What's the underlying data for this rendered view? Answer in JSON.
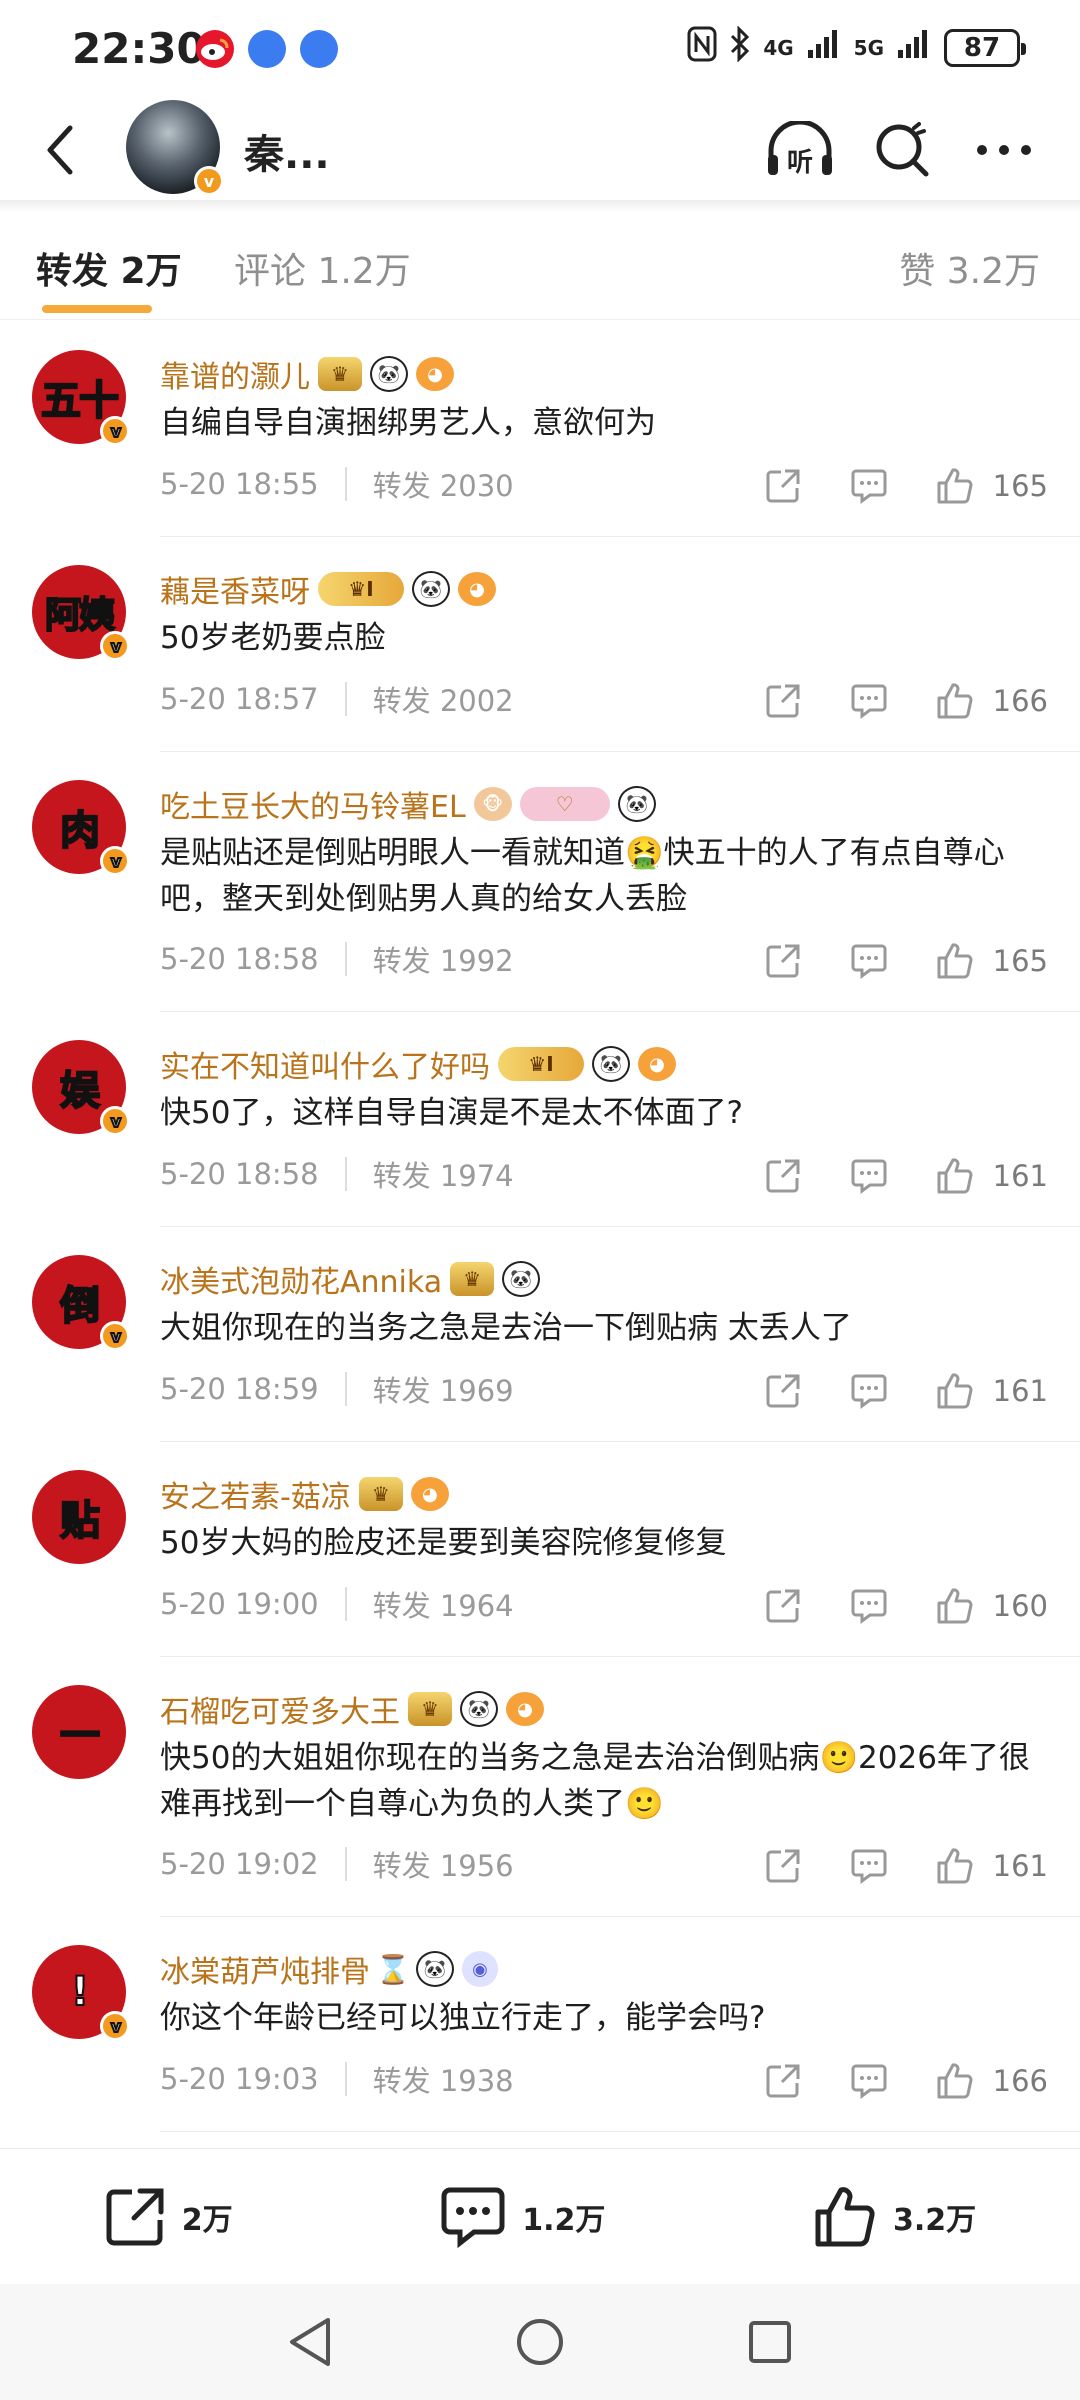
{
  "status_bar": {
    "time": "22:30",
    "network_1": "4G",
    "network_2": "5G",
    "battery": "87"
  },
  "header": {
    "title": "秦...",
    "listen_label": "听"
  },
  "tabs": [
    {
      "label": "转发 2万"
    },
    {
      "label": "评论 1.2万"
    },
    {
      "label": "赞 3.2万"
    }
  ],
  "items": [
    {
      "avatar_text": "五十",
      "name": "靠谱的灏儿",
      "badges": [
        "crown",
        "panda",
        "fish"
      ],
      "text": "自编自导自演捆绑男艺人，意欲何为",
      "time": "5-20 18:55",
      "repost": "转发 2030",
      "likes": "165"
    },
    {
      "avatar_text": "阿姨",
      "name": "藕是香菜呀",
      "badges": [
        "level",
        "panda",
        "fish"
      ],
      "level_label": "I",
      "text": "50岁老奶要点脸",
      "time": "5-20 18:57",
      "repost": "转发 2002",
      "likes": "166"
    },
    {
      "avatar_text": "肉",
      "name": "吃土豆长大的马铃薯EL",
      "badges": [
        "monkey",
        "pink",
        "panda"
      ],
      "text": "是贴贴还是倒贴明眼人一看就知道🤮快五十的人了有点自尊心吧，整天到处倒贴男人真的给女人丢脸",
      "time": "5-20 18:58",
      "repost": "转发 1992",
      "likes": "165"
    },
    {
      "avatar_text": "娱",
      "name": "实在不知道叫什么了好吗",
      "badges": [
        "level",
        "panda",
        "fish"
      ],
      "level_label": "I",
      "text": "快50了，这样自导自演是不是太不体面了?",
      "time": "5-20 18:58",
      "repost": "转发 1974",
      "likes": "161"
    },
    {
      "avatar_text": "倒",
      "name": "冰美式泡勋花Annika",
      "badges": [
        "crown",
        "panda"
      ],
      "text": "大姐你现在的当务之急是去治一下倒贴病 太丢人了",
      "time": "5-20 18:59",
      "repost": "转发 1969",
      "likes": "161"
    },
    {
      "avatar_text": "贴",
      "name": "安之若素-菇凉",
      "badges": [
        "crown",
        "fish"
      ],
      "text": "50岁大妈的脸皮还是要到美容院修复修复",
      "time": "5-20 19:00",
      "repost": "转发 1964",
      "likes": "160"
    },
    {
      "avatar_text": "一",
      "name": "石榴吃可爱多大王",
      "badges": [
        "crown",
        "panda",
        "fish"
      ],
      "text": "快50的大姐姐你现在的当务之急是去治治倒贴病🙂2026年了很难再找到一个自尊心为负的人类了🙂",
      "time": "5-20 19:02",
      "repost": "转发 1956",
      "likes": "161"
    },
    {
      "avatar_text": "!",
      "name": "冰棠葫芦炖排骨",
      "badges": [
        "hourglass",
        "panda",
        "eye"
      ],
      "text": "你这个年龄已经可以独立行走了，能学会吗?",
      "time": "5-20 19:03",
      "repost": "转发 1938",
      "likes": "166"
    }
  ],
  "bottom_bar": {
    "repost_count": "2万",
    "comment_count": "1.2万",
    "like_count": "3.2万"
  },
  "icons": {
    "back": "chevron-left-icon",
    "listen": "headphones-icon",
    "search": "search-icon",
    "more": "more-icon",
    "share": "share-icon",
    "comment": "comment-icon",
    "like": "thumbs-up-icon"
  },
  "colors": {
    "accent": "#f7a83a",
    "username": "#b9731a",
    "avatar_red": "#c4161c"
  }
}
